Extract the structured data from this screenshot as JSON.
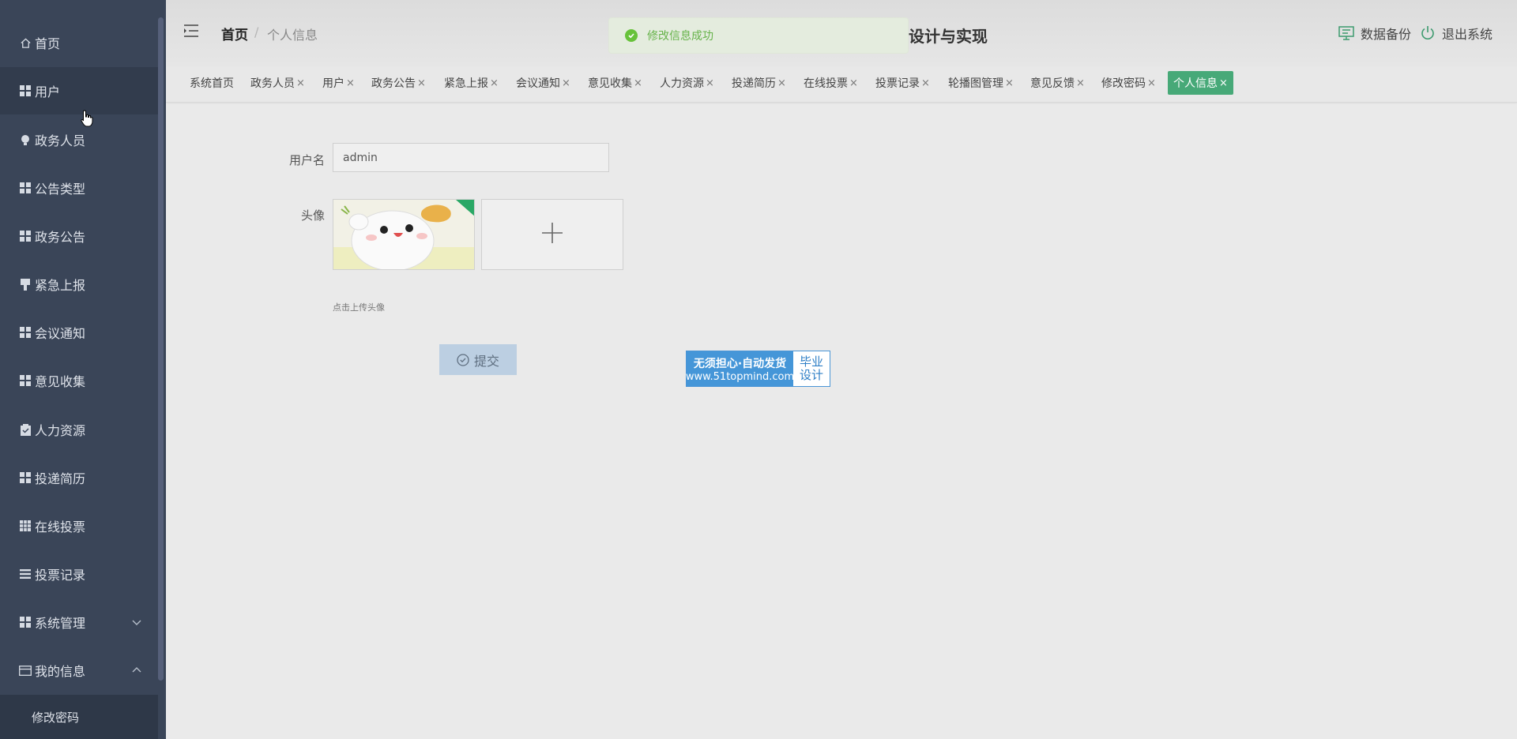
{
  "sidebar": {
    "items": [
      {
        "label": "首页",
        "icon": "home-icon"
      },
      {
        "label": "用户",
        "icon": "grid-icon"
      },
      {
        "label": "政务人员",
        "icon": "bulb-icon"
      },
      {
        "label": "公告类型",
        "icon": "grid-icon"
      },
      {
        "label": "政务公告",
        "icon": "grid-icon"
      },
      {
        "label": "紧急上报",
        "icon": "brush-icon"
      },
      {
        "label": "会议通知",
        "icon": "grid-icon"
      },
      {
        "label": "意见收集",
        "icon": "grid-icon"
      },
      {
        "label": "人力资源",
        "icon": "clipboard-icon"
      },
      {
        "label": "投递简历",
        "icon": "grid-icon"
      },
      {
        "label": "在线投票",
        "icon": "table-icon"
      },
      {
        "label": "投票记录",
        "icon": "list-icon"
      },
      {
        "label": "系统管理",
        "icon": "grid-icon"
      },
      {
        "label": "我的信息",
        "icon": "card-icon"
      }
    ],
    "submenu_item": "修改密码"
  },
  "header": {
    "breadcrumb_home": "首页",
    "breadcrumb_sep": "/",
    "breadcrumb_current": "个人信息",
    "system_title": "设计与实现",
    "backup_label": "数据备份",
    "logout_label": "退出系统"
  },
  "toast": {
    "message": "修改信息成功"
  },
  "tabs": [
    {
      "label": "系统首页",
      "closable": false
    },
    {
      "label": "政务人员",
      "closable": true
    },
    {
      "label": "用户",
      "closable": true
    },
    {
      "label": "政务公告",
      "closable": true
    },
    {
      "label": "紧急上报",
      "closable": true
    },
    {
      "label": "会议通知",
      "closable": true
    },
    {
      "label": "意见收集",
      "closable": true
    },
    {
      "label": "人力资源",
      "closable": true
    },
    {
      "label": "投递简历",
      "closable": true
    },
    {
      "label": "在线投票",
      "closable": true
    },
    {
      "label": "投票记录",
      "closable": true
    },
    {
      "label": "轮播图管理",
      "closable": true
    },
    {
      "label": "意见反馈",
      "closable": true
    },
    {
      "label": "修改密码",
      "closable": true
    },
    {
      "label": "个人信息",
      "closable": true,
      "active": true
    }
  ],
  "tab_close_glyph": "×",
  "form": {
    "username_label": "用户名",
    "username_value": "admin",
    "avatar_label": "头像",
    "upload_tip": "点击上传头像",
    "submit_label": "提交"
  },
  "watermark": {
    "line1": "无须担心·自动发货",
    "line2": "www.51topmind.com",
    "right_line1": "毕业",
    "right_line2": "设计"
  },
  "colors": {
    "sidebar_bg": "#3a4558",
    "active_tab": "#47a978",
    "toast_text": "#66b34a",
    "submit_bg": "#bccfe2"
  }
}
